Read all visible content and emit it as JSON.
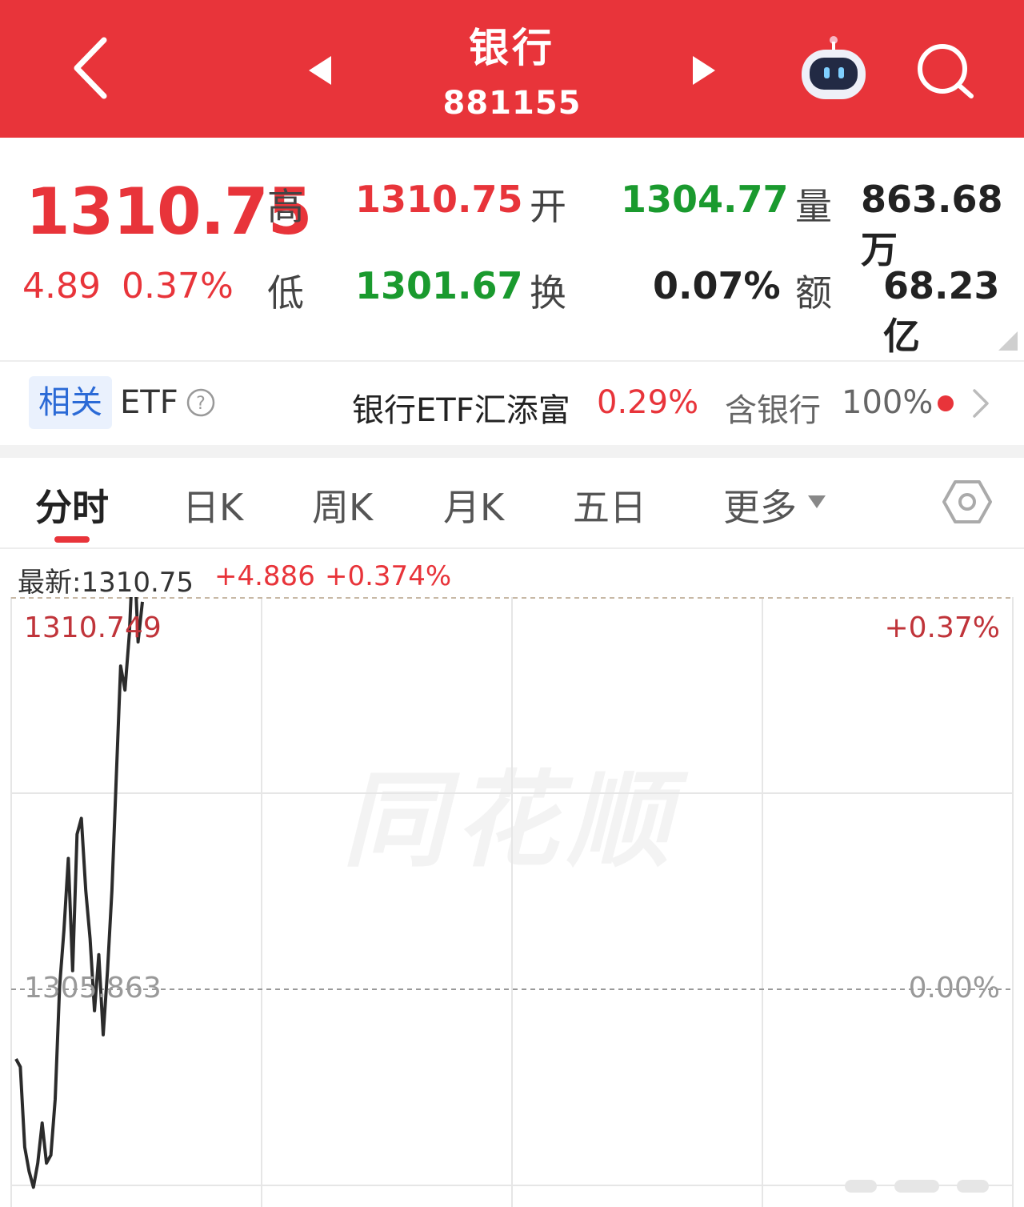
{
  "header": {
    "title": "银行",
    "code": "881155"
  },
  "quote": {
    "price": "1310.75",
    "change": "4.89",
    "change_pct": "0.37%",
    "high_label": "高",
    "high": "1310.75",
    "low_label": "低",
    "low": "1301.67",
    "open_label": "开",
    "open": "1304.77",
    "turnover_label": "换",
    "turnover": "0.07%",
    "volume_label": "量",
    "volume": "863.68万",
    "amount_label": "额",
    "amount": "68.23亿"
  },
  "etf": {
    "tag": "相关",
    "label": "ETF",
    "name": "银行ETF汇添富",
    "pct": "0.29%",
    "holding_label": "含银行",
    "holding_value": "100%"
  },
  "tabs": [
    {
      "label": "分时",
      "active": true
    },
    {
      "label": "日K",
      "active": false
    },
    {
      "label": "周K",
      "active": false
    },
    {
      "label": "月K",
      "active": false
    },
    {
      "label": "五日",
      "active": false
    },
    {
      "label": "更多",
      "active": false
    }
  ],
  "chart": {
    "latest_label": "最新:1310.75",
    "latest_change": "+4.886",
    "latest_pct": "+0.374%",
    "top_price": "1310.749",
    "top_pct": "+0.37%",
    "base_price": "1305.863",
    "base_pct": "0.00%",
    "watermark": "同花顺"
  },
  "colors": {
    "brand": "#e8343a",
    "up": "#e8343a",
    "down": "#1a9a2e"
  },
  "chart_data": {
    "type": "line",
    "title": "",
    "series": [
      {
        "values": [
          1305.0,
          1304.9,
          1303.9,
          1303.6,
          1303.4,
          1303.7,
          1304.2,
          1303.7,
          1303.8,
          1304.5,
          1305.9,
          1306.6,
          1307.5,
          1306.1,
          1307.8,
          1308.0,
          1307.1,
          1306.5,
          1305.6,
          1306.3,
          1305.3,
          1306.1,
          1307.1,
          1308.5,
          1309.9,
          1309.6,
          1310.3,
          1311.5,
          1310.2,
          1310.7
        ]
      }
    ],
    "ylim": [
      1300.977,
      1310.749
    ],
    "reference": 1305.863
  }
}
